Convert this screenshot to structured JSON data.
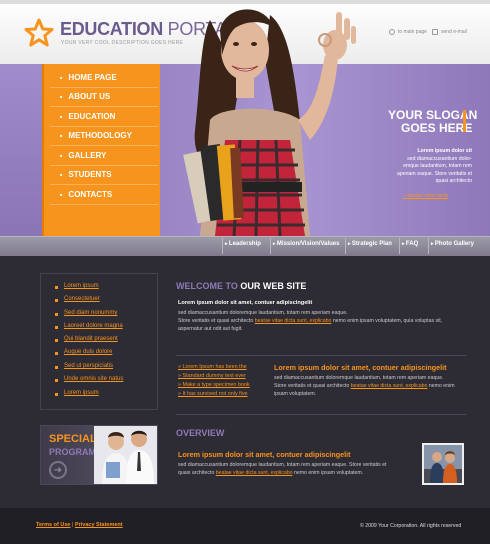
{
  "header": {
    "title_main": "EDUCATION",
    "title_second": "PORTAL",
    "subtitle": "YOUR VERY COOL DESCRIPTION GOES HERE",
    "links": [
      {
        "label": "to main page",
        "icon": "home-icon"
      },
      {
        "label": "send e-mail",
        "icon": "mail-icon"
      }
    ]
  },
  "nav": {
    "items": [
      "HOME PAGE",
      "ABOUT US",
      "EDUCATION",
      "METHODOLOGY",
      "GALLERY",
      "STUDENTS",
      "CONTACTS"
    ]
  },
  "hero": {
    "slogan_line1": "YOUR SLOGAN",
    "slogan_line2": "GOES HERE",
    "text_bold": "Lorem ipsum dolor sit",
    "text": "sed diamaccusantium dolor-emque laudantium, totam rem aperiam eaque. Store veritatis et quasi architecto",
    "link": "beatae vitae dicta"
  },
  "submenu": {
    "items": [
      "Leadership",
      "Mission/Vision/Values",
      "Strategic Plan",
      "FAQ",
      "Photo Gallery"
    ]
  },
  "sidebar": {
    "links": [
      "Lorem ipsum",
      "Consectetuer",
      "Sed diam nonummy",
      "Laoreet dolore magna",
      "Qui blandit praesent",
      "Augue duis dolore",
      "Sed ut perspiciatis",
      "Unde omnis site natus",
      "Lorem ipsum"
    ],
    "special_line1": "SPECIAL",
    "special_line2": "PROGRAMM"
  },
  "welcome": {
    "heading_part1": "WELCOME TO",
    "heading_part2": "OUR WEB SITE",
    "bold": "Lorem ipsum dolor sit amet, contuer adipiscingelit",
    "text_a": "sed diamaccusantium doloremque laudantium, totam rem aperiam eaque.",
    "text_b": "Store veritatis et quasi architecto",
    "link_b": "beatae vitae dicta sunt, explicabo",
    "text_c": "nemo enim ipsam voluptatem, quia voluptas sit,",
    "text_d": "aspernatur aut odit aut fugit."
  },
  "list_links": [
    "Lorem Ipsum has been the",
    "Standard dummy text ever",
    "Make a type specimen book",
    "It has survived not only five"
  ],
  "middle": {
    "heading": "Lorem ipsum dolor sit amet, contuer adipiscingelit",
    "text_a": "sed diamaccusantium doloremque laudantium, totam rem aperiam eaque.",
    "text_b": "Store veritatis et quasi architecto",
    "link_b": "beatae vitae dicta sunt, explicabo",
    "text_c": "nemo enim",
    "text_d": "ipsam voluptatem."
  },
  "overview": {
    "heading": "OVERVIEW",
    "title": "Lorem ipsum dolor sit amet, contuer adipiscingelit",
    "text_a": "sed diamaccusantium doloremque laudantium, totam rem aperiam eaque. Store veritatis et",
    "text_b": "quasi architecto",
    "link": "beatae vitae dicta sunt, explicabo",
    "text_c": "nemo enim ipsam voluptatem."
  },
  "footer": {
    "terms": "Terms of Use",
    "separator": "|",
    "privacy": "Privacy Statement",
    "copyright": "© 2009 Your Corporation. All rights reserved"
  },
  "colors": {
    "accent": "#f7941d",
    "purple": "#8d7bb5",
    "dark_bg": "#2d2b34"
  }
}
